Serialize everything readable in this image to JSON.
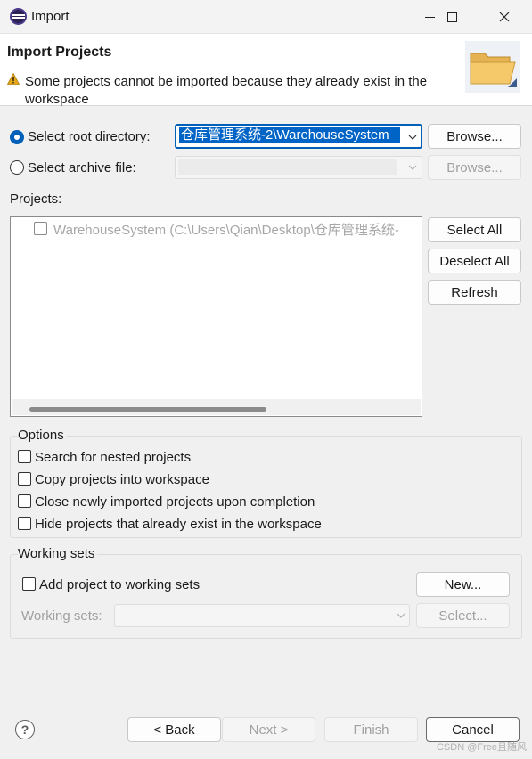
{
  "window": {
    "title": "Import"
  },
  "banner": {
    "title": "Import Projects",
    "message": "Some projects cannot be imported because they already exist in the workspace"
  },
  "source": {
    "root_dir_label": "Select root directory:",
    "root_dir_value": "仓库管理系统-2\\WarehouseSystem",
    "archive_label": "Select archive file:",
    "browse_label": "Browse...",
    "browse_archive_label": "Browse..."
  },
  "projects": {
    "label": "Projects:",
    "items": [
      {
        "name": "WarehouseSystem (C:\\Users\\Qian\\Desktop\\仓库管理系统-",
        "checked": false
      }
    ],
    "select_all": "Select All",
    "deselect_all": "Deselect All",
    "refresh": "Refresh"
  },
  "options": {
    "title": "Options",
    "items": [
      {
        "label": "Search for nested projects",
        "checked": false
      },
      {
        "label": "Copy projects into workspace",
        "checked": false
      },
      {
        "label": "Close newly imported projects upon completion",
        "checked": false
      },
      {
        "label": "Hide projects that already exist in the workspace",
        "checked": false
      }
    ]
  },
  "working_sets": {
    "title": "Working sets",
    "add_label": "Add project to working sets",
    "new_button": "New...",
    "sets_label": "Working sets:",
    "select_button": "Select..."
  },
  "footer": {
    "back": "< Back",
    "next": "Next >",
    "finish": "Finish",
    "cancel": "Cancel",
    "help_icon_text": "?",
    "watermark": "CSDN @Free且随风"
  },
  "colors": {
    "accent": "#005fb8",
    "selection": "#0063c6",
    "warning": "#e6a817",
    "folder": "#f5c86a"
  },
  "icons": [
    "eclipse-app-icon",
    "minimize-icon",
    "maximize-icon",
    "close-icon",
    "warning-icon",
    "folder-icon",
    "chevron-down-icon",
    "help-icon"
  ]
}
